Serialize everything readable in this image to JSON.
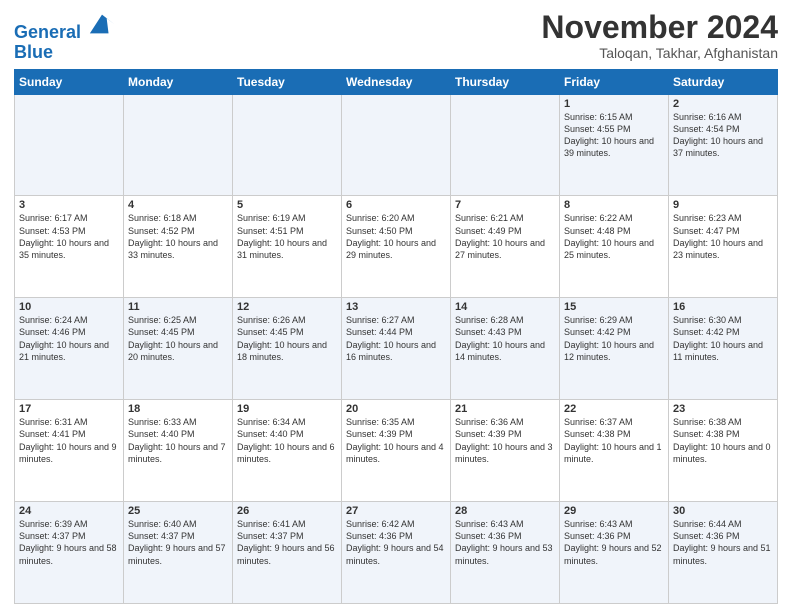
{
  "header": {
    "logo_line1": "General",
    "logo_line2": "Blue",
    "month": "November 2024",
    "location": "Taloqan, Takhar, Afghanistan"
  },
  "weekdays": [
    "Sunday",
    "Monday",
    "Tuesday",
    "Wednesday",
    "Thursday",
    "Friday",
    "Saturday"
  ],
  "rows": [
    [
      {
        "day": "",
        "info": ""
      },
      {
        "day": "",
        "info": ""
      },
      {
        "day": "",
        "info": ""
      },
      {
        "day": "",
        "info": ""
      },
      {
        "day": "",
        "info": ""
      },
      {
        "day": "1",
        "info": "Sunrise: 6:15 AM\nSunset: 4:55 PM\nDaylight: 10 hours and 39 minutes."
      },
      {
        "day": "2",
        "info": "Sunrise: 6:16 AM\nSunset: 4:54 PM\nDaylight: 10 hours and 37 minutes."
      }
    ],
    [
      {
        "day": "3",
        "info": "Sunrise: 6:17 AM\nSunset: 4:53 PM\nDaylight: 10 hours and 35 minutes."
      },
      {
        "day": "4",
        "info": "Sunrise: 6:18 AM\nSunset: 4:52 PM\nDaylight: 10 hours and 33 minutes."
      },
      {
        "day": "5",
        "info": "Sunrise: 6:19 AM\nSunset: 4:51 PM\nDaylight: 10 hours and 31 minutes."
      },
      {
        "day": "6",
        "info": "Sunrise: 6:20 AM\nSunset: 4:50 PM\nDaylight: 10 hours and 29 minutes."
      },
      {
        "day": "7",
        "info": "Sunrise: 6:21 AM\nSunset: 4:49 PM\nDaylight: 10 hours and 27 minutes."
      },
      {
        "day": "8",
        "info": "Sunrise: 6:22 AM\nSunset: 4:48 PM\nDaylight: 10 hours and 25 minutes."
      },
      {
        "day": "9",
        "info": "Sunrise: 6:23 AM\nSunset: 4:47 PM\nDaylight: 10 hours and 23 minutes."
      }
    ],
    [
      {
        "day": "10",
        "info": "Sunrise: 6:24 AM\nSunset: 4:46 PM\nDaylight: 10 hours and 21 minutes."
      },
      {
        "day": "11",
        "info": "Sunrise: 6:25 AM\nSunset: 4:45 PM\nDaylight: 10 hours and 20 minutes."
      },
      {
        "day": "12",
        "info": "Sunrise: 6:26 AM\nSunset: 4:45 PM\nDaylight: 10 hours and 18 minutes."
      },
      {
        "day": "13",
        "info": "Sunrise: 6:27 AM\nSunset: 4:44 PM\nDaylight: 10 hours and 16 minutes."
      },
      {
        "day": "14",
        "info": "Sunrise: 6:28 AM\nSunset: 4:43 PM\nDaylight: 10 hours and 14 minutes."
      },
      {
        "day": "15",
        "info": "Sunrise: 6:29 AM\nSunset: 4:42 PM\nDaylight: 10 hours and 12 minutes."
      },
      {
        "day": "16",
        "info": "Sunrise: 6:30 AM\nSunset: 4:42 PM\nDaylight: 10 hours and 11 minutes."
      }
    ],
    [
      {
        "day": "17",
        "info": "Sunrise: 6:31 AM\nSunset: 4:41 PM\nDaylight: 10 hours and 9 minutes."
      },
      {
        "day": "18",
        "info": "Sunrise: 6:33 AM\nSunset: 4:40 PM\nDaylight: 10 hours and 7 minutes."
      },
      {
        "day": "19",
        "info": "Sunrise: 6:34 AM\nSunset: 4:40 PM\nDaylight: 10 hours and 6 minutes."
      },
      {
        "day": "20",
        "info": "Sunrise: 6:35 AM\nSunset: 4:39 PM\nDaylight: 10 hours and 4 minutes."
      },
      {
        "day": "21",
        "info": "Sunrise: 6:36 AM\nSunset: 4:39 PM\nDaylight: 10 hours and 3 minutes."
      },
      {
        "day": "22",
        "info": "Sunrise: 6:37 AM\nSunset: 4:38 PM\nDaylight: 10 hours and 1 minute."
      },
      {
        "day": "23",
        "info": "Sunrise: 6:38 AM\nSunset: 4:38 PM\nDaylight: 10 hours and 0 minutes."
      }
    ],
    [
      {
        "day": "24",
        "info": "Sunrise: 6:39 AM\nSunset: 4:37 PM\nDaylight: 9 hours and 58 minutes."
      },
      {
        "day": "25",
        "info": "Sunrise: 6:40 AM\nSunset: 4:37 PM\nDaylight: 9 hours and 57 minutes."
      },
      {
        "day": "26",
        "info": "Sunrise: 6:41 AM\nSunset: 4:37 PM\nDaylight: 9 hours and 56 minutes."
      },
      {
        "day": "27",
        "info": "Sunrise: 6:42 AM\nSunset: 4:36 PM\nDaylight: 9 hours and 54 minutes."
      },
      {
        "day": "28",
        "info": "Sunrise: 6:43 AM\nSunset: 4:36 PM\nDaylight: 9 hours and 53 minutes."
      },
      {
        "day": "29",
        "info": "Sunrise: 6:43 AM\nSunset: 4:36 PM\nDaylight: 9 hours and 52 minutes."
      },
      {
        "day": "30",
        "info": "Sunrise: 6:44 AM\nSunset: 4:36 PM\nDaylight: 9 hours and 51 minutes."
      }
    ]
  ]
}
